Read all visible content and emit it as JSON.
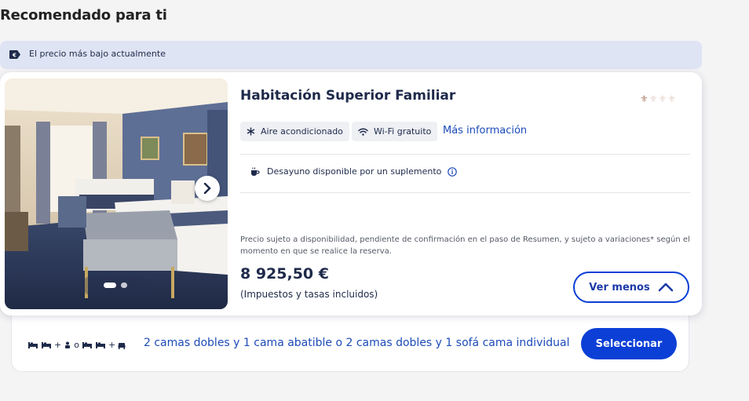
{
  "section": {
    "title": "Recomendado para ti"
  },
  "banner": {
    "icon": "price-tag-icon",
    "text": "El precio más bajo actualmente"
  },
  "room": {
    "title": "Habitación Superior Familiar",
    "rating": {
      "max": 4,
      "filled": 1,
      "icon": "fleur-de-lis-icon"
    },
    "amenities": [
      {
        "icon": "snowflake-icon",
        "label": "Aire acondicionado"
      },
      {
        "icon": "wifi-icon",
        "label": "Wi-Fi gratuito"
      }
    ],
    "more_info_label": "Más información",
    "breakfast": {
      "icon": "breakfast-icon",
      "text": "Desayuno disponible por un suplemento",
      "info_icon": "info-icon"
    },
    "disclaimer": "Precio sujeto a disponibilidad, pendiente de confirmación en el paso de Resumen, y sujeto a variaciones* según el momento en que se realice la reserva.",
    "price": "8 925,50 €",
    "taxes_note": "(Impuestos y tasas incluidos)",
    "toggle_label": "Ver menos",
    "gallery": {
      "current": 1,
      "total": 2
    }
  },
  "beds": {
    "icons": [
      "bed-icon",
      "bed-icon",
      "+",
      "person-icon",
      "o",
      "bed-icon",
      "bed-icon",
      "+",
      "sofa-bed-icon"
    ],
    "description": "2 camas dobles y 1 cama abatible o 2 camas dobles y 1 sofá cama individual",
    "select_label": "Seleccionar"
  },
  "colors": {
    "accent": "#0b3fd6",
    "link": "#1c4bb8",
    "banner_bg": "#dfe4f4",
    "text": "#1e2a4a"
  }
}
